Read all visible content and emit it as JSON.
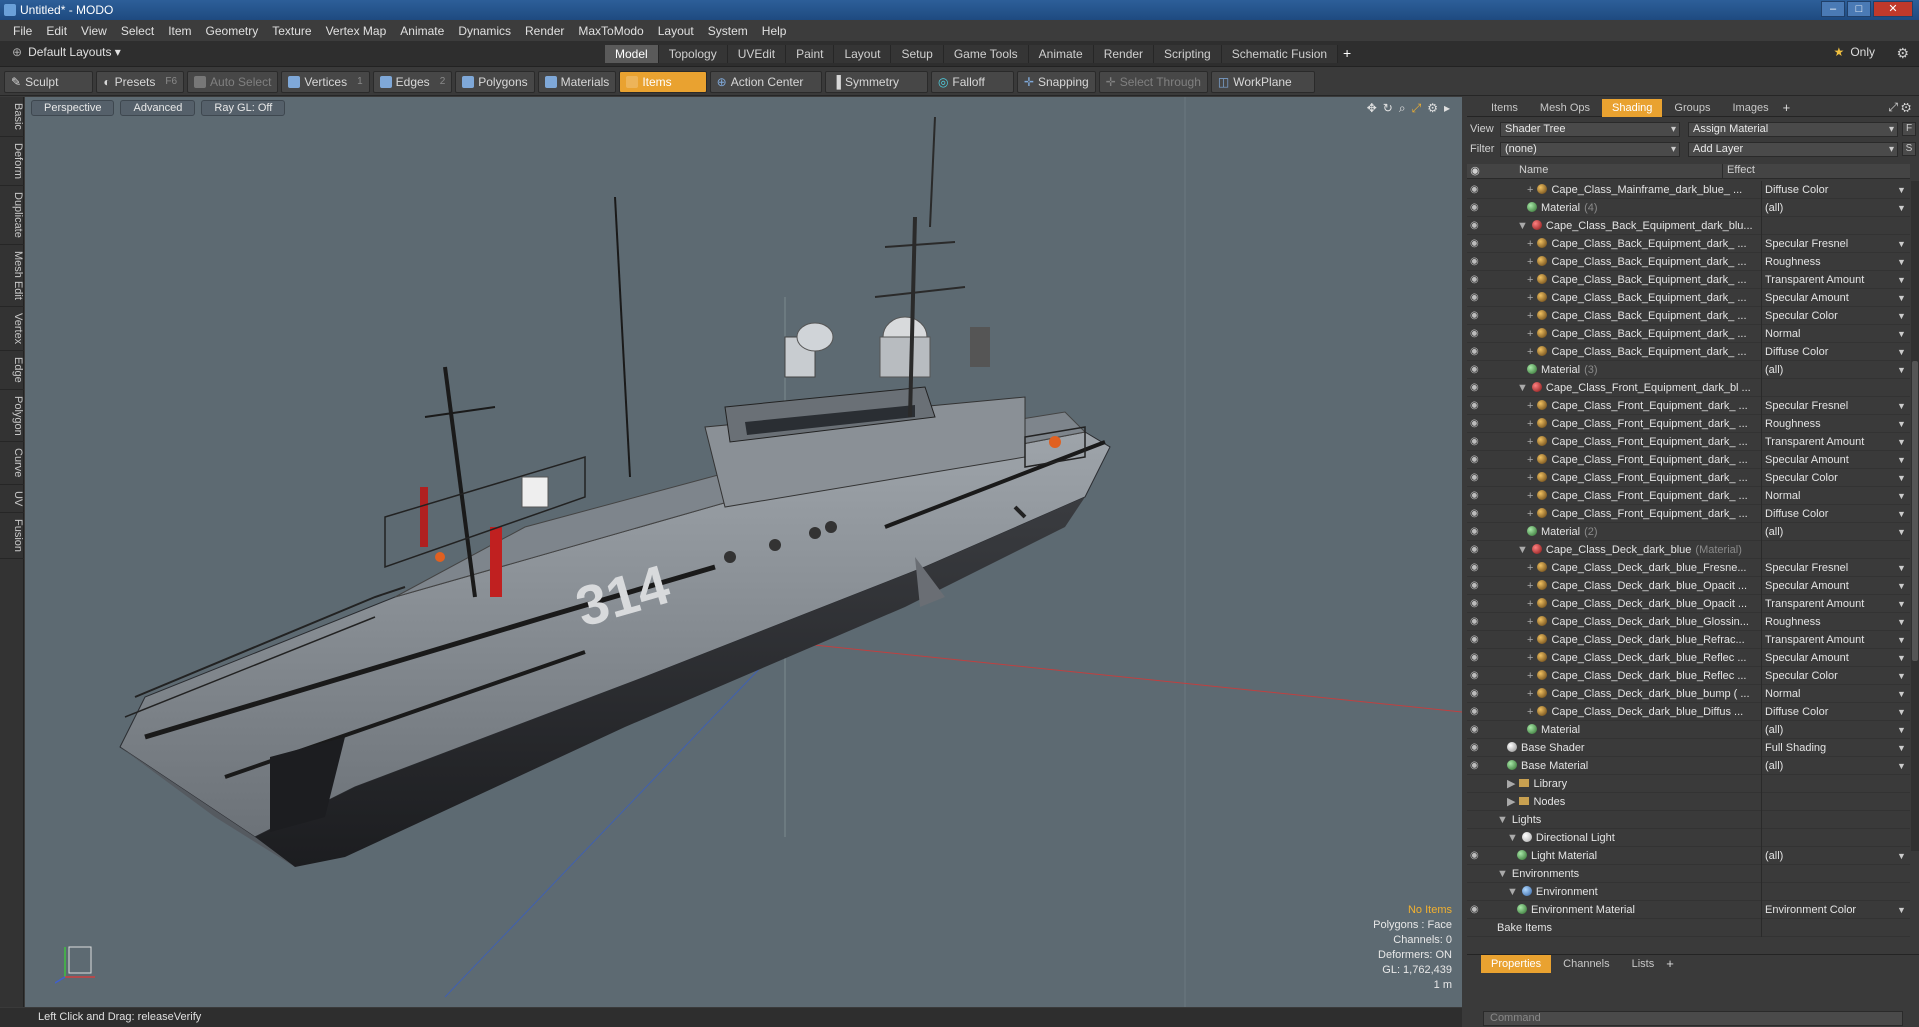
{
  "window": {
    "title": "Untitled* - MODO"
  },
  "menu": [
    "File",
    "Edit",
    "View",
    "Select",
    "Item",
    "Geometry",
    "Texture",
    "Vertex Map",
    "Animate",
    "Dynamics",
    "Render",
    "MaxToModo",
    "Layout",
    "System",
    "Help"
  ],
  "layouts": {
    "current": "Default Layouts",
    "tabs": [
      "Model",
      "Topology",
      "UVEdit",
      "Paint",
      "Layout",
      "Setup",
      "Game Tools",
      "Animate",
      "Render",
      "Scripting",
      "Schematic Fusion"
    ],
    "active": "Model",
    "only_label": "Only"
  },
  "toolbar": {
    "sculpt": "Sculpt",
    "presets": "Presets",
    "presets_key": "F6",
    "auto_select": "Auto Select",
    "vertices": "Vertices",
    "vertices_key": "1",
    "edges": "Edges",
    "edges_key": "2",
    "polygons": "Polygons",
    "materials": "Materials",
    "items": "Items",
    "action_center": "Action Center",
    "symmetry": "Symmetry",
    "falloff": "Falloff",
    "snapping": "Snapping",
    "select_through": "Select Through",
    "workplane": "WorkPlane"
  },
  "left_tabs": [
    "Basic",
    "Deform",
    "Duplicate",
    "Mesh Edit",
    "Vertex",
    "Edge",
    "Polygon",
    "Curve",
    "UV",
    "Fusion"
  ],
  "viewport": {
    "view": "Perspective",
    "style": "Advanced",
    "raygl": "Ray GL: Off",
    "hull_number": "314",
    "info": {
      "no_items": "No Items",
      "polygons": "Polygons : Face",
      "channels": "Channels: 0",
      "deformers": "Deformers: ON",
      "gl": "GL: 1,762,439",
      "scale": "1 m"
    }
  },
  "panel": {
    "tabs": [
      "Items",
      "Mesh Ops",
      "Shading",
      "Groups",
      "Images"
    ],
    "active_tab": "Shading",
    "view_label": "View",
    "view_value": "Shader Tree",
    "assign": "Assign Material",
    "assign_key": "F",
    "filter_label": "Filter",
    "filter_value": "(none)",
    "add_layer": "Add Layer",
    "add_layer_key": "S",
    "col_name": "Name",
    "col_effect": "Effect",
    "bottom_tabs": [
      "Properties",
      "Channels",
      "Lists"
    ],
    "bottom_active": "Properties",
    "command_placeholder": "Command"
  },
  "tree": [
    {
      "indent": 5,
      "kind": "bul",
      "exp": "+",
      "name": "Cape_Class_Mainframe_dark_blue_ ...",
      "effect": "Diffuse Color"
    },
    {
      "indent": 5,
      "kind": "mat",
      "exp": "",
      "name": "Material",
      "dim": "(4)",
      "effect": "(all)"
    },
    {
      "indent": 4,
      "kind": "grp",
      "exp": "▼",
      "name": "Cape_Class_Back_Equipment_dark_blu...",
      "effect": ""
    },
    {
      "indent": 5,
      "kind": "bul",
      "exp": "+",
      "name": "Cape_Class_Back_Equipment_dark_ ...",
      "effect": "Specular Fresnel"
    },
    {
      "indent": 5,
      "kind": "bul",
      "exp": "+",
      "name": "Cape_Class_Back_Equipment_dark_ ...",
      "effect": "Roughness"
    },
    {
      "indent": 5,
      "kind": "bul",
      "exp": "+",
      "name": "Cape_Class_Back_Equipment_dark_ ...",
      "effect": "Transparent Amount"
    },
    {
      "indent": 5,
      "kind": "bul",
      "exp": "+",
      "name": "Cape_Class_Back_Equipment_dark_ ...",
      "effect": "Specular Amount"
    },
    {
      "indent": 5,
      "kind": "bul",
      "exp": "+",
      "name": "Cape_Class_Back_Equipment_dark_ ...",
      "effect": "Specular Color"
    },
    {
      "indent": 5,
      "kind": "bul",
      "exp": "+",
      "name": "Cape_Class_Back_Equipment_dark_ ...",
      "effect": "Normal"
    },
    {
      "indent": 5,
      "kind": "bul",
      "exp": "+",
      "name": "Cape_Class_Back_Equipment_dark_ ...",
      "effect": "Diffuse Color"
    },
    {
      "indent": 5,
      "kind": "mat",
      "exp": "",
      "name": "Material",
      "dim": "(3)",
      "effect": "(all)"
    },
    {
      "indent": 4,
      "kind": "grp",
      "exp": "▼",
      "name": "Cape_Class_Front_Equipment_dark_bl ...",
      "effect": ""
    },
    {
      "indent": 5,
      "kind": "bul",
      "exp": "+",
      "name": "Cape_Class_Front_Equipment_dark_ ...",
      "effect": "Specular Fresnel"
    },
    {
      "indent": 5,
      "kind": "bul",
      "exp": "+",
      "name": "Cape_Class_Front_Equipment_dark_ ...",
      "effect": "Roughness"
    },
    {
      "indent": 5,
      "kind": "bul",
      "exp": "+",
      "name": "Cape_Class_Front_Equipment_dark_ ...",
      "effect": "Transparent Amount"
    },
    {
      "indent": 5,
      "kind": "bul",
      "exp": "+",
      "name": "Cape_Class_Front_Equipment_dark_ ...",
      "effect": "Specular Amount"
    },
    {
      "indent": 5,
      "kind": "bul",
      "exp": "+",
      "name": "Cape_Class_Front_Equipment_dark_ ...",
      "effect": "Specular Color"
    },
    {
      "indent": 5,
      "kind": "bul",
      "exp": "+",
      "name": "Cape_Class_Front_Equipment_dark_ ...",
      "effect": "Normal"
    },
    {
      "indent": 5,
      "kind": "bul",
      "exp": "+",
      "name": "Cape_Class_Front_Equipment_dark_ ...",
      "effect": "Diffuse Color"
    },
    {
      "indent": 5,
      "kind": "mat",
      "exp": "",
      "name": "Material",
      "dim": "(2)",
      "effect": "(all)"
    },
    {
      "indent": 4,
      "kind": "grp",
      "exp": "▼",
      "name": "Cape_Class_Deck_dark_blue",
      "dim": "(Material)",
      "effect": ""
    },
    {
      "indent": 5,
      "kind": "bul",
      "exp": "+",
      "name": "Cape_Class_Deck_dark_blue_Fresne...",
      "effect": "Specular Fresnel"
    },
    {
      "indent": 5,
      "kind": "bul",
      "exp": "+",
      "name": "Cape_Class_Deck_dark_blue_Opacit ...",
      "effect": "Specular Amount"
    },
    {
      "indent": 5,
      "kind": "bul",
      "exp": "+",
      "name": "Cape_Class_Deck_dark_blue_Opacit ...",
      "effect": "Transparent Amount"
    },
    {
      "indent": 5,
      "kind": "bul",
      "exp": "+",
      "name": "Cape_Class_Deck_dark_blue_Glossin...",
      "effect": "Roughness"
    },
    {
      "indent": 5,
      "kind": "bul",
      "exp": "+",
      "name": "Cape_Class_Deck_dark_blue_Refrac...",
      "effect": "Transparent Amount"
    },
    {
      "indent": 5,
      "kind": "bul",
      "exp": "+",
      "name": "Cape_Class_Deck_dark_blue_Reflec ...",
      "effect": "Specular Amount"
    },
    {
      "indent": 5,
      "kind": "bul",
      "exp": "+",
      "name": "Cape_Class_Deck_dark_blue_Reflec ...",
      "effect": "Specular Color"
    },
    {
      "indent": 5,
      "kind": "bul",
      "exp": "+",
      "name": "Cape_Class_Deck_dark_blue_bump ( ...",
      "effect": "Normal"
    },
    {
      "indent": 5,
      "kind": "bul",
      "exp": "+",
      "name": "Cape_Class_Deck_dark_blue_Diffus ...",
      "effect": "Diffuse Color"
    },
    {
      "indent": 5,
      "kind": "mat",
      "exp": "",
      "name": "Material",
      "effect": "(all)"
    },
    {
      "indent": 3,
      "kind": "shd",
      "exp": "",
      "name": "Base Shader",
      "effect": "Full Shading"
    },
    {
      "indent": 3,
      "kind": "mat",
      "exp": "",
      "name": "Base Material",
      "effect": "(all)"
    },
    {
      "indent": 3,
      "kind": "fold",
      "exp": "▶",
      "name": "Library",
      "effect": "",
      "noeye": true
    },
    {
      "indent": 3,
      "kind": "fold",
      "exp": "▶",
      "name": "Nodes",
      "effect": "",
      "noeye": true
    },
    {
      "indent": 2,
      "kind": "none",
      "exp": "▼",
      "name": "Lights",
      "effect": "",
      "noeye": true
    },
    {
      "indent": 3,
      "kind": "lgt",
      "exp": "▼",
      "name": "Directional Light",
      "effect": "",
      "noeye": true
    },
    {
      "indent": 4,
      "kind": "mat",
      "exp": "",
      "name": "Light Material",
      "effect": "(all)"
    },
    {
      "indent": 2,
      "kind": "none",
      "exp": "▼",
      "name": "Environments",
      "effect": "",
      "noeye": true
    },
    {
      "indent": 3,
      "kind": "env",
      "exp": "▼",
      "name": "Environment",
      "effect": "",
      "noeye": true
    },
    {
      "indent": 4,
      "kind": "mat",
      "exp": "",
      "name": "Environment Material",
      "effect": "Environment Color"
    },
    {
      "indent": 2,
      "kind": "none",
      "exp": "",
      "name": "Bake Items",
      "effect": "",
      "noeye": true
    }
  ],
  "status": {
    "text": "Left Click and Drag:   releaseVerify"
  }
}
